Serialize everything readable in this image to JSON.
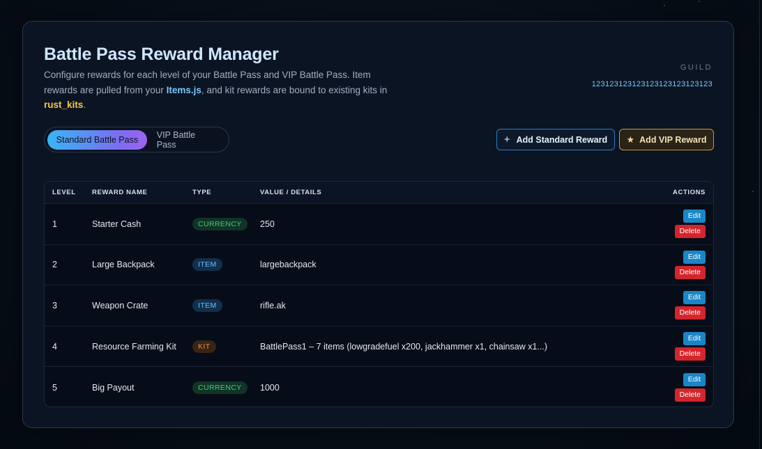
{
  "header": {
    "title": "Battle Pass Reward Manager",
    "desc_part1": "Configure rewards for each level of your Battle Pass and VIP Battle Pass. Item rewards are pulled from your ",
    "desc_items_file": "Items.js",
    "desc_part2": ", and kit rewards are bound to existing kits in ",
    "desc_kits_table": "rust_kits",
    "desc_part3": ".",
    "guild_label": "GUILD",
    "guild_id": "123123123123123123123123123"
  },
  "tabs": [
    {
      "label": "Standard Battle Pass",
      "active": true
    },
    {
      "label": "VIP Battle Pass",
      "active": false
    }
  ],
  "actions": {
    "add_standard": "Add Standard Reward",
    "add_vip": "Add VIP Reward"
  },
  "table": {
    "columns": [
      "LEVEL",
      "REWARD NAME",
      "TYPE",
      "VALUE / DETAILS",
      "ACTIONS"
    ],
    "edit_label": "Edit",
    "delete_label": "Delete",
    "rows": [
      {
        "level": "1",
        "name": "Starter Cash",
        "type": "CURRENCY",
        "type_class": "currency",
        "value": "250"
      },
      {
        "level": "2",
        "name": "Large Backpack",
        "type": "ITEM",
        "type_class": "item",
        "value": "largebackpack"
      },
      {
        "level": "3",
        "name": "Weapon Crate",
        "type": "ITEM",
        "type_class": "item",
        "value": "rifle.ak"
      },
      {
        "level": "4",
        "name": "Resource Farming Kit",
        "type": "KIT",
        "type_class": "kit",
        "value": "BattlePass1 – 7 items (lowgradefuel x200, jackhammer x1, chainsaw x1...)"
      },
      {
        "level": "5",
        "name": "Big Payout",
        "type": "CURRENCY",
        "type_class": "currency",
        "value": "1000"
      }
    ]
  },
  "colors": {
    "accent": "#38b6f5",
    "vip": "#c79a3c",
    "edit": "#1a86c7",
    "delete": "#d5252c"
  }
}
